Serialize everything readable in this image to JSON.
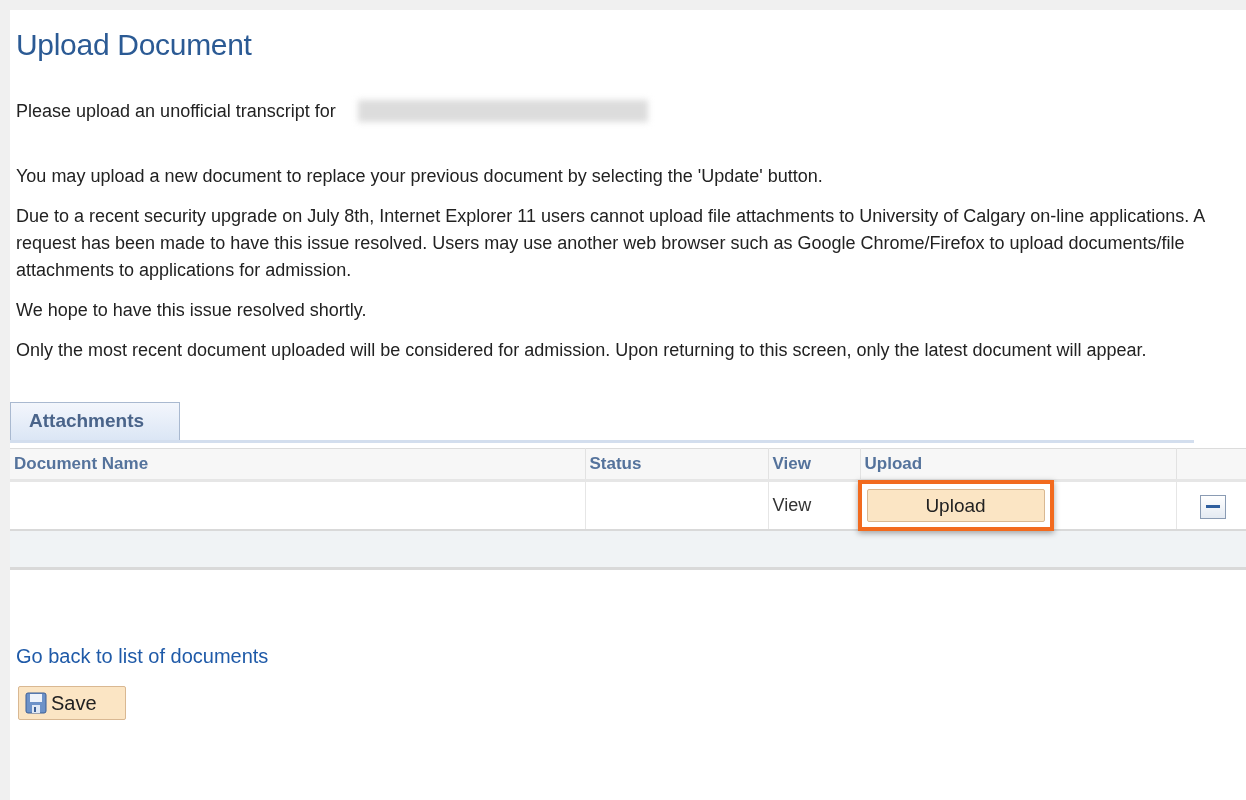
{
  "page": {
    "title": "Upload Document"
  },
  "intro": {
    "text": "Please upload an unofficial transcript for",
    "name_redacted": true
  },
  "paragraphs": [
    "You may upload a new document to replace your previous document by selecting the 'Update' button.",
    "Due to a recent security upgrade on July 8th, Internet Explorer 11 users cannot upload file attachments to University of Calgary on-line applications. A request has been made to have this issue resolved. Users may use another web browser such as Google Chrome/Firefox to upload documents/file attachments to applications for admission.",
    "We hope to have this issue resolved shortly.",
    "Only the most recent document uploaded will be considered for admission. Upon returning to this screen, only the latest document will appear."
  ],
  "attachments": {
    "tab": "Attachments",
    "columns": [
      "Document Name",
      "Status",
      "View",
      "Upload"
    ],
    "rows": [
      {
        "document_name": "",
        "status": "",
        "view": "View",
        "upload": "Upload",
        "upload_highlighted": true
      }
    ]
  },
  "back_link": "Go back to list of documents",
  "save_button": "Save"
}
